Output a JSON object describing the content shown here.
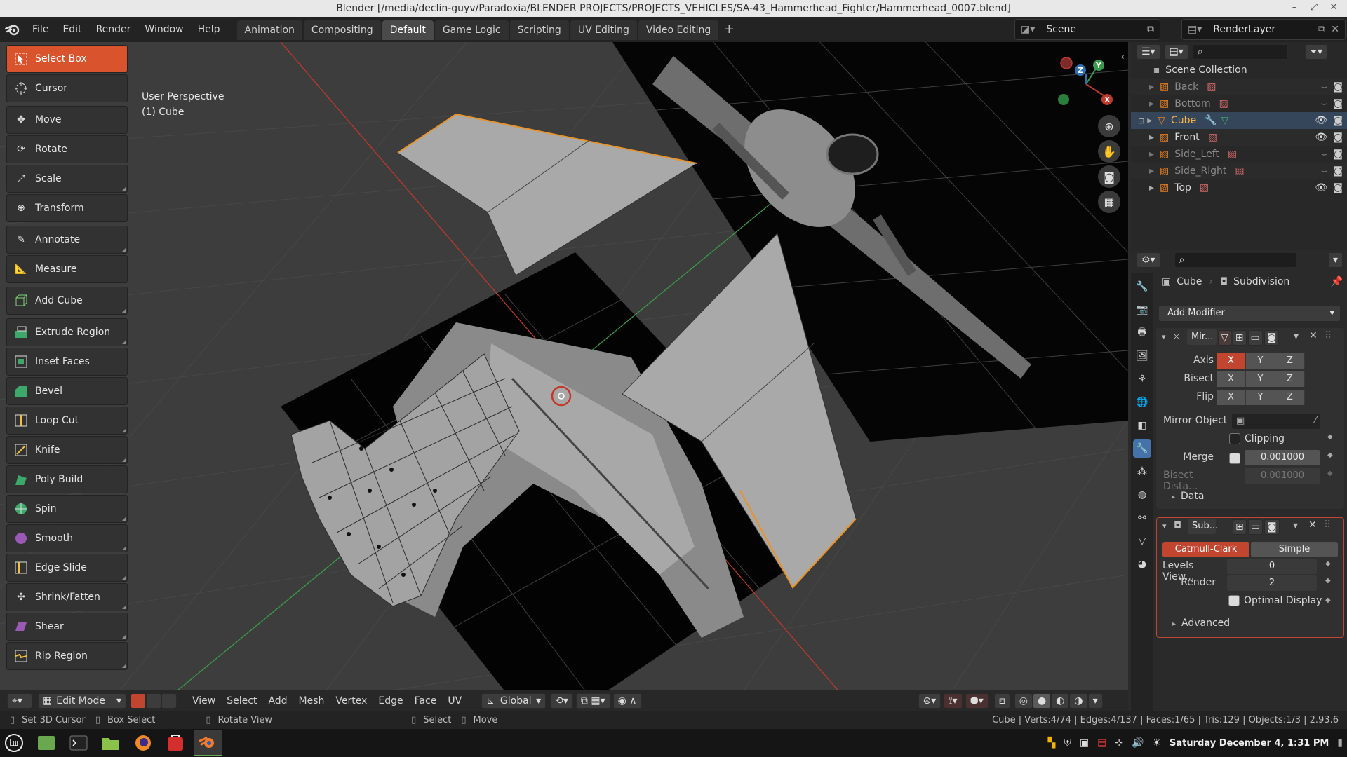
{
  "window": {
    "title": "Blender [/media/declin-guyv/Paradoxia/BLENDER PROJECTS/PROJECTS_VEHICLES/SA-43_Hammerhead_Fighter/Hammerhead_0007.blend]",
    "minimize": "–",
    "maximize": "⤢",
    "close": "✕"
  },
  "topbar": {
    "menus": [
      "File",
      "Edit",
      "Render",
      "Window",
      "Help"
    ],
    "workspaces": [
      "Animation",
      "Compositing",
      "Default",
      "Game Logic",
      "Scripting",
      "UV Editing",
      "Video Editing"
    ],
    "active_workspace": "Default",
    "add": "+",
    "scene": "Scene",
    "render_layer": "RenderLayer"
  },
  "toolbar": {
    "tools": [
      {
        "label": "Select Box",
        "active": true
      },
      {
        "label": "Cursor"
      },
      {
        "label": "Move"
      },
      {
        "label": "Rotate"
      },
      {
        "label": "Scale"
      },
      {
        "label": "Transform"
      },
      {
        "label": "Annotate"
      },
      {
        "label": "Measure"
      },
      {
        "label": "Add Cube"
      },
      {
        "label": "Extrude Region"
      },
      {
        "label": "Inset Faces"
      },
      {
        "label": "Bevel"
      },
      {
        "label": "Loop Cut"
      },
      {
        "label": "Knife"
      },
      {
        "label": "Poly Build"
      },
      {
        "label": "Spin"
      },
      {
        "label": "Smooth"
      },
      {
        "label": "Edge Slide"
      },
      {
        "label": "Shrink/Fatten"
      },
      {
        "label": "Shear"
      },
      {
        "label": "Rip Region"
      }
    ]
  },
  "viewport": {
    "perspective": "User Perspective",
    "object": "(1) Cube",
    "gizmo": {
      "x": "X",
      "y": "Y",
      "z": "Z"
    },
    "colors": {
      "bg": "#3d3d3d",
      "x_axis": "#c0392b",
      "y_axis": "#3a9b4a",
      "wing": "#a9a9a9",
      "selected_edge": "#e8932a"
    }
  },
  "vp_header": {
    "mode": "Edit Mode",
    "menus": [
      "View",
      "Select",
      "Add",
      "Mesh",
      "Vertex",
      "Edge",
      "Face",
      "UV"
    ],
    "orientation": "Global"
  },
  "status": {
    "left": [
      "Set 3D Cursor",
      "Box Select",
      "Rotate View",
      "Select",
      "Move"
    ],
    "stats": "Cube | Verts:4/74 | Edges:4/137 | Faces:1/65 | Tris:129 | Objects:1/3 | 2.93.6"
  },
  "outliner": {
    "collection": "Scene Collection",
    "items": [
      {
        "name": "Back",
        "visible": false
      },
      {
        "name": "Bottom",
        "visible": false
      },
      {
        "name": "Cube",
        "visible": true,
        "selected": true
      },
      {
        "name": "Front",
        "visible": true
      },
      {
        "name": "Side_Left",
        "visible": false
      },
      {
        "name": "Side_Right",
        "visible": false
      },
      {
        "name": "Top",
        "visible": true
      }
    ]
  },
  "properties": {
    "object": "Cube",
    "modifier_context": "Subdivision",
    "add_modifier": "Add Modifier",
    "mirror": {
      "name": "Mir...",
      "axis_label": "Axis",
      "bisect_label": "Bisect",
      "flip_label": "Flip",
      "axes": [
        "X",
        "Y",
        "Z"
      ],
      "mirror_object_label": "Mirror Object",
      "clipping_label": "Clipping",
      "merge_label": "Merge",
      "merge_value": "0.001000",
      "bisect_distance_label": "Bisect Dista...",
      "bisect_distance_value": "0.001000",
      "data_label": "Data"
    },
    "subdivision": {
      "name": "Sub...",
      "catmull": "Catmull-Clark",
      "simple": "Simple",
      "levels_label": "Levels View...",
      "levels_value": "0",
      "render_label": "Render",
      "render_value": "2",
      "optimal_label": "Optimal Display",
      "advanced_label": "Advanced"
    }
  },
  "taskbar": {
    "clock": "Saturday December  4,  1:31 PM"
  }
}
